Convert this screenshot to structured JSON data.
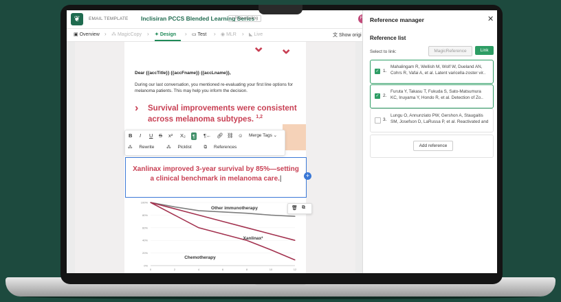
{
  "app": {
    "template_label": "EMAIL TEMPLATE",
    "template_title": "Inclisiran PCCS Blended Learning Series",
    "status_badge": "Non existing",
    "avatar_initials": "FS"
  },
  "breadcrumbs": [
    {
      "label": "Overview"
    },
    {
      "label": "MagicCopy"
    },
    {
      "label": "Design"
    },
    {
      "label": "Test"
    },
    {
      "label": "MLR"
    },
    {
      "label": "Live"
    }
  ],
  "show_original": "Show origi",
  "email": {
    "greeting": "Dear {{accTitle}} {{accFname}} {{accLname}},",
    "body": "During our last conversation, you mentioned re-evaluating your first line options for melanoma patients. This may help you inform the decision.",
    "headline": "Survival improvements were consistent across melanoma subtypes.",
    "headline_refs": "1,2",
    "selected_text_line1": "Xanlinax improved 3-year survival by 85%—setting",
    "selected_text_line2": "a clinical benchmark in melanoma care."
  },
  "toolbar": {
    "bold": "B",
    "italic": "I",
    "underline": "U",
    "strike": "S",
    "superscript": "x²",
    "subscript": "X₂",
    "merge_tags": "Merge Tags",
    "rewrite": "Rewrite",
    "picklist": "Picklist",
    "references": "References"
  },
  "chart_data": {
    "type": "line",
    "x": [
      0,
      2,
      4,
      6,
      8,
      10,
      12
    ],
    "ylim": [
      0,
      100
    ],
    "yticks": [
      "100%",
      "80%",
      "60%",
      "40%",
      "20%",
      "0%"
    ],
    "xticks": [
      "0",
      "2",
      "4",
      "6",
      "8",
      "10",
      "12"
    ],
    "series": [
      {
        "name": "Other immunotherapy",
        "values": [
          100,
          93,
          87,
          85,
          83,
          80,
          78
        ],
        "color": "#7d7d7d"
      },
      {
        "name": "Xanlinax²",
        "values": [
          100,
          90,
          80,
          70,
          60,
          50,
          40
        ],
        "color": "#a3324f"
      },
      {
        "name": "Chemotherapy",
        "values": [
          100,
          80,
          60,
          50,
          40,
          25,
          9
        ],
        "color": "#a3324f"
      }
    ]
  },
  "panel": {
    "title": "Reference manager",
    "list_title": "Reference list",
    "select_to_link": "Select to link:",
    "magic_reference": "MagicReference",
    "link": "Link",
    "add_reference": "Add reference",
    "references": [
      {
        "num": "1.",
        "line1": "Mahalingam R, Wellish M, Wolf W, Dueland AN,",
        "line2": "Cohrs R, Vafai A, et al. Latent varicella-zoster vir..",
        "checked": true
      },
      {
        "num": "2.",
        "line1": "Furuta Y, Takasu T, Fukuda S, Sato-Matsumura",
        "line2": "KC, Inuyama Y, Hondo R, et al. Detection of Zo..",
        "checked": true
      },
      {
        "num": "3.",
        "line1": "Lungu O, Annunziato PW, Gershon A, Staugaitis",
        "line2": "SM, Josefson D, LaRussa P, et al. Reactivated and",
        "checked": false
      }
    ]
  },
  "colors": {
    "accent": "#1f8a58",
    "brand_red": "#c84054",
    "selection": "#3a78d6",
    "background": "#1d4a3e"
  }
}
